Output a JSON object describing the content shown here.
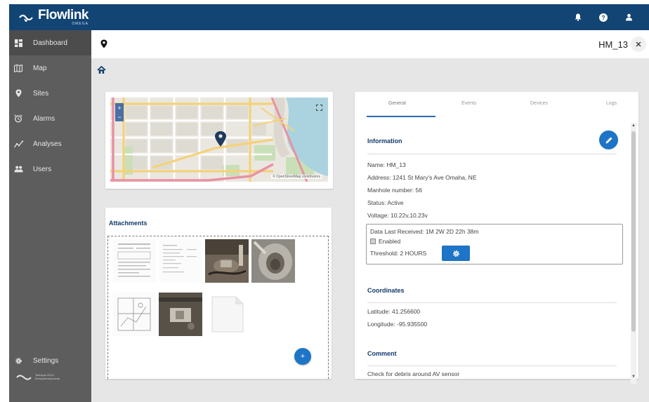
{
  "brand": {
    "name": "Flowlink",
    "sub": "OMEGA"
  },
  "sidebar": {
    "items": [
      {
        "label": "Dashboard",
        "icon": "dashboard-icon"
      },
      {
        "label": "Map",
        "icon": "map-icon"
      },
      {
        "label": "Sites",
        "icon": "location-pin-icon"
      },
      {
        "label": "Alarms",
        "icon": "alarm-clock-icon"
      },
      {
        "label": "Analyses",
        "icon": "chart-icon"
      },
      {
        "label": "Users",
        "icon": "users-icon"
      }
    ],
    "settings_label": "Settings",
    "footer_brand": "Teledyne ISCO",
    "footer_sub": "Everywhereyoulook"
  },
  "header": {
    "site_id": "HM_13"
  },
  "map": {
    "attribution": "© OpenStreetMap contributors"
  },
  "attachments": {
    "title": "Attachments",
    "add_label": "+"
  },
  "tabs": [
    "General",
    "Events",
    "Devices",
    "Logs"
  ],
  "information": {
    "title": "Information",
    "name": "Name: HM_13",
    "address": "Address: 1241 St Mary's Ave Omaha, NE",
    "manhole": "Manhole number: 56",
    "status": "Status: Active",
    "voltage": "Voltage: 10.22v,10.23v",
    "last_received": "Data Last Received: 1M 2W 2D 22h 38m",
    "enabled_label": "Enabled",
    "threshold": "Threshold: 2 HOURS"
  },
  "coordinates": {
    "title": "Coordinates",
    "latitude": "Latitude: 41.256600",
    "longitude": "Longitude: -95.935500"
  },
  "comment": {
    "title": "Comment",
    "text": "Check for debris around AV sensor"
  },
  "colors": {
    "topbar": "#124474",
    "sidebar": "#5d5d5d",
    "accent": "#1e74c6",
    "section_title": "#123a6b"
  }
}
